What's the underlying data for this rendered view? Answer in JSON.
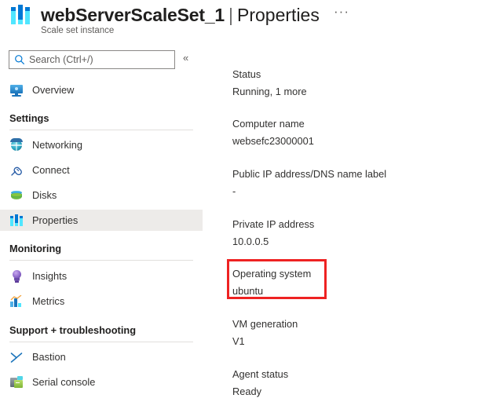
{
  "header": {
    "resource_name": "webServerScaleSet_1",
    "separator": "|",
    "page_name": "Properties",
    "subtitle": "Scale set instance",
    "more_menu": "···",
    "icon": "scale-set-icon"
  },
  "sidebar": {
    "search": {
      "placeholder": "Search (Ctrl+/)",
      "value": "",
      "icon": "search-icon"
    },
    "collapse": "«",
    "top_items": [
      {
        "label": "Overview",
        "icon": "monitor-icon",
        "selected": false
      }
    ],
    "sections": [
      {
        "title": "Settings",
        "items": [
          {
            "label": "Networking",
            "icon": "globe-icon",
            "selected": false
          },
          {
            "label": "Connect",
            "icon": "plug-icon",
            "selected": false
          },
          {
            "label": "Disks",
            "icon": "disk-icon",
            "selected": false
          },
          {
            "label": "Properties",
            "icon": "scale-set-icon",
            "selected": true
          }
        ]
      },
      {
        "title": "Monitoring",
        "items": [
          {
            "label": "Insights",
            "icon": "lightbulb-icon",
            "selected": false
          },
          {
            "label": "Metrics",
            "icon": "bar-chart-icon",
            "selected": false
          }
        ]
      },
      {
        "title": "Support + troubleshooting",
        "items": [
          {
            "label": "Bastion",
            "icon": "bastion-icon",
            "selected": false
          },
          {
            "label": "Serial console",
            "icon": "console-icon",
            "selected": false
          }
        ]
      }
    ]
  },
  "main": {
    "properties": [
      {
        "label": "Status",
        "value": "Running, 1 more"
      },
      {
        "label": "Computer name",
        "value": "websefc23000001"
      },
      {
        "label": "Public IP address/DNS name label",
        "value": "-"
      },
      {
        "label": "Private IP address",
        "value": "10.0.0.5"
      },
      {
        "label": "Operating system",
        "value": "ubuntu"
      },
      {
        "label": "VM generation",
        "value": "V1"
      },
      {
        "label": "Agent status",
        "value": "Ready"
      }
    ]
  },
  "annotation": {
    "highlight_target": "Operating system",
    "highlight_color": "#ee2222"
  }
}
